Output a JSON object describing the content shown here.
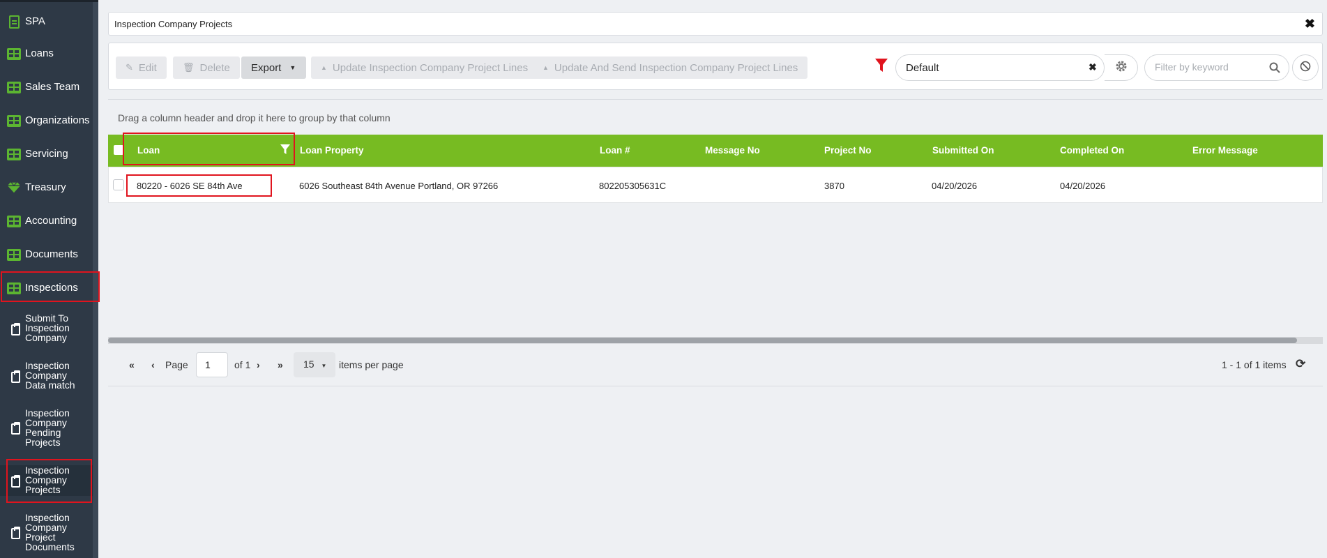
{
  "sidebar": {
    "items": [
      {
        "label": "SPA",
        "icon": "document-icon"
      },
      {
        "label": "Loans",
        "icon": "grid-icon"
      },
      {
        "label": "Sales Team",
        "icon": "grid-icon"
      },
      {
        "label": "Organizations",
        "icon": "grid-icon"
      },
      {
        "label": "Servicing",
        "icon": "grid-icon"
      },
      {
        "label": "Treasury",
        "icon": "diamond-icon"
      },
      {
        "label": "Accounting",
        "icon": "grid-icon"
      },
      {
        "label": "Documents",
        "icon": "grid-icon"
      },
      {
        "label": "Inspections",
        "icon": "grid-icon"
      }
    ],
    "sub_items": [
      {
        "label": "Submit To Inspection Company",
        "lines": [
          "Submit To",
          "Inspection",
          "Company"
        ]
      },
      {
        "label": "Inspection Company Data match",
        "lines": [
          "Inspection",
          "Company",
          "Data match"
        ]
      },
      {
        "label": "Inspection Company Pending Projects",
        "lines": [
          "Inspection",
          "Company",
          "Pending",
          "Projects"
        ]
      },
      {
        "label": "Inspection Company Projects",
        "lines": [
          "Inspection",
          "Company",
          "Projects"
        ]
      },
      {
        "label": "Inspection Company Project Documents",
        "lines": [
          "Inspection",
          "Company",
          "Project",
          "Documents"
        ]
      }
    ]
  },
  "tab": {
    "title": "Inspection Company Projects"
  },
  "toolbar": {
    "edit": "Edit",
    "delete": "Delete",
    "export": "Export",
    "update_lines": "Update Inspection Company Project Lines",
    "update_send_lines": "Update And Send Inspection Company Project Lines",
    "view_value": "Default",
    "search_placeholder": "Filter by keyword"
  },
  "grid": {
    "group_hint": "Drag a column header and drop it here to group by that column",
    "columns": [
      "Loan",
      "Loan Property",
      "Loan #",
      "Message No",
      "Project No",
      "Submitted On",
      "Completed On",
      "Error Message"
    ],
    "rows": [
      {
        "loan": "80220 - 6026 SE 84th Ave",
        "property": "6026 Southeast 84th Avenue Portland, OR 97266",
        "loan_no": "802205305631C",
        "message_no": "",
        "project_no": "3870",
        "submitted_on": "04/20/2026",
        "completed_on": "04/20/2026",
        "error_message": ""
      }
    ]
  },
  "pager": {
    "page_label": "Page",
    "page_value": "1",
    "of_label": "of 1",
    "per_page_value": "15",
    "per_page_label": "items per page",
    "summary": "1 - 1 of 1 items"
  },
  "colors": {
    "header_green": "#77bb22",
    "sidebar_bg": "#2e3946",
    "highlight_red": "#e0141e"
  }
}
